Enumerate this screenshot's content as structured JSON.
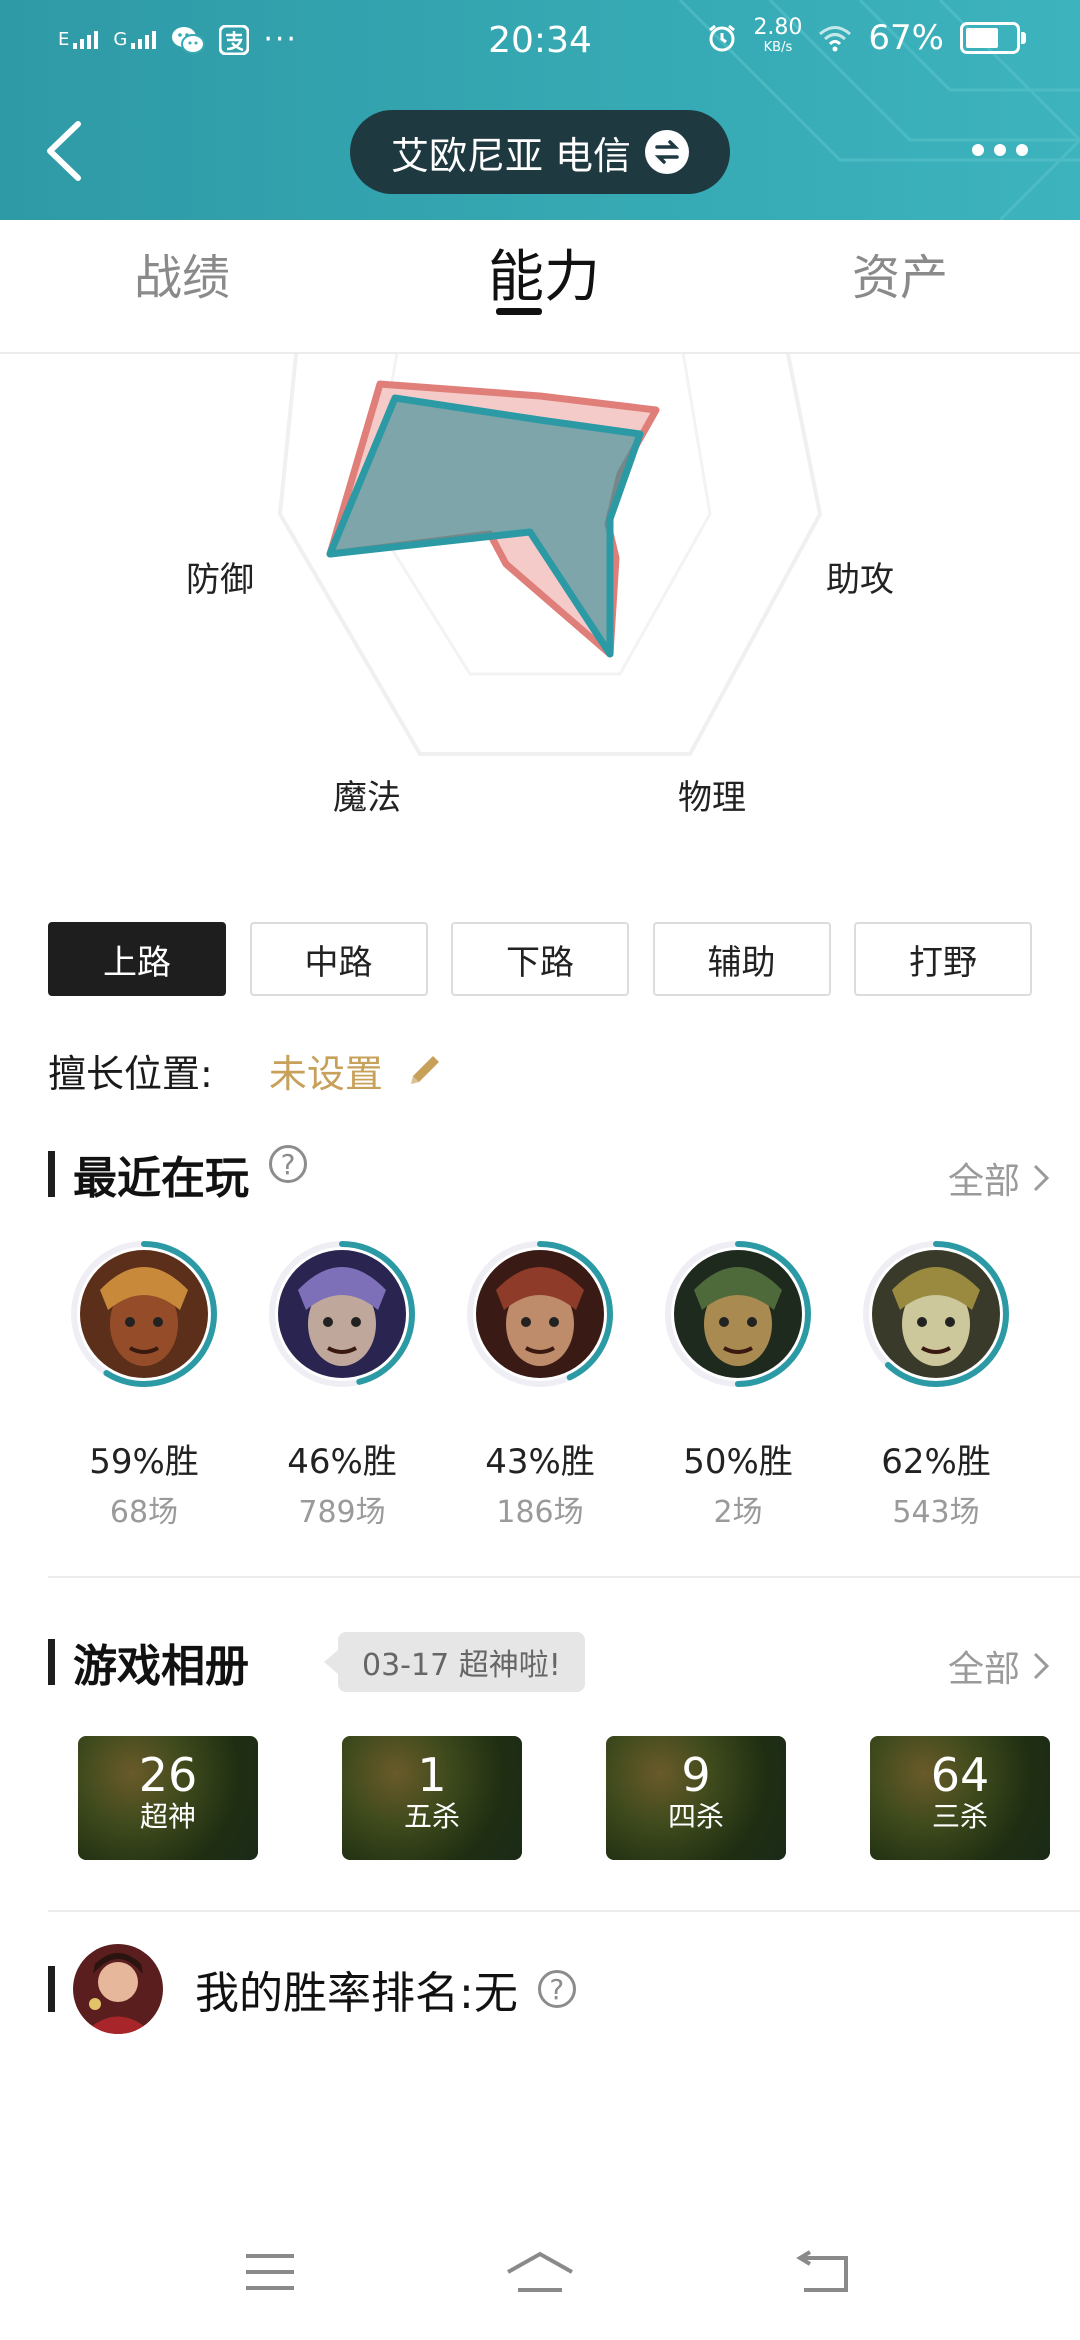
{
  "status_bar": {
    "signal_1": "E",
    "signal_2": "G",
    "time": "20:34",
    "speed_value": "2.80",
    "speed_unit": "KB/s",
    "battery": "67%",
    "battery_level": 0.67
  },
  "header": {
    "server": "艾欧尼亚 电信"
  },
  "tabs": [
    {
      "label": "战绩",
      "active": false
    },
    {
      "label": "能力",
      "active": true
    },
    {
      "label": "资产",
      "active": false
    }
  ],
  "radar": {
    "labels": {
      "left": "防御",
      "right": "助攻",
      "bottom_left": "魔法",
      "bottom_right": "物理"
    }
  },
  "lanes": [
    {
      "label": "上路",
      "active": true
    },
    {
      "label": "中路",
      "active": false
    },
    {
      "label": "下路",
      "active": false
    },
    {
      "label": "辅助",
      "active": false
    },
    {
      "label": "打野",
      "active": false
    }
  ],
  "position": {
    "label": "擅长位置:",
    "value": "未设置"
  },
  "recent": {
    "title": "最近在玩",
    "all_label": "全部",
    "heroes": [
      {
        "rate": "59%胜",
        "games": "68场",
        "win_fraction": 0.59
      },
      {
        "rate": "46%胜",
        "games": "789场",
        "win_fraction": 0.46
      },
      {
        "rate": "43%胜",
        "games": "186场",
        "win_fraction": 0.43
      },
      {
        "rate": "50%胜",
        "games": "2场",
        "win_fraction": 0.5
      },
      {
        "rate": "62%胜",
        "games": "543场",
        "win_fraction": 0.62
      }
    ]
  },
  "album": {
    "title": "游戏相册",
    "bubble": "03-17 超神啦!",
    "all_label": "全部",
    "items": [
      {
        "count": "26",
        "label": "超神"
      },
      {
        "count": "1",
        "label": "五杀"
      },
      {
        "count": "9",
        "label": "四杀"
      },
      {
        "count": "64",
        "label": "三杀"
      }
    ]
  },
  "ranking": {
    "label": "我的胜率排名:",
    "value": "无"
  },
  "colors": {
    "header": "#36aab4",
    "accent_teal": "#2b9aa5",
    "series_pink": "#e07f7a",
    "gold": "#c7a059"
  }
}
